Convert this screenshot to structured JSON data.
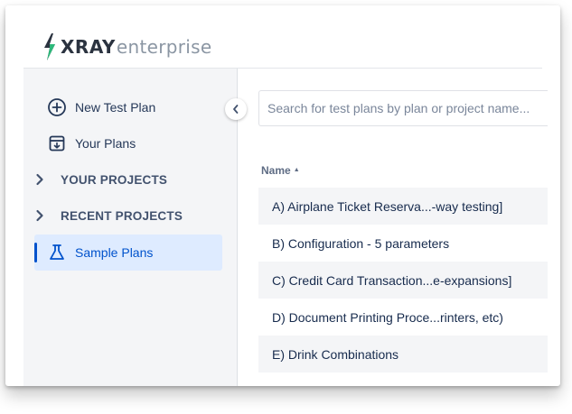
{
  "brand": {
    "name_bold": "XRAY",
    "name_light": "enterprise",
    "icon": "lightning-bolt-icon",
    "colors": {
      "bolt_dark": "#2b3340",
      "bolt_accent": "#2db87a"
    }
  },
  "sidebar": {
    "items": [
      {
        "label": "New Test Plan",
        "icon": "plus-circle-icon"
      },
      {
        "label": "Your Plans",
        "icon": "archive-box-icon"
      },
      {
        "label": "YOUR PROJECTS",
        "icon": "chevron-right-icon"
      },
      {
        "label": "RECENT PROJECTS",
        "icon": "chevron-right-icon"
      },
      {
        "label": "Sample Plans",
        "icon": "flask-icon",
        "active": true
      }
    ],
    "collapse_icon": "chevron-left-icon"
  },
  "search": {
    "placeholder": "Search for test plans by plan or project name..."
  },
  "table": {
    "column_name": "Name",
    "sort_indicator": "▲",
    "rows": [
      "A) Airplane Ticket Reserva...-way testing]",
      "B) Configuration - 5 parameters",
      "C) Credit Card Transaction...e-expansions]",
      "D) Document Printing Proce...rinters, etc)",
      "E) Drink Combinations"
    ]
  },
  "colors": {
    "accent": "#0052cc",
    "active_bg": "#deebff",
    "sidebar_bg": "#f4f5f7",
    "text": "#172b4d"
  }
}
